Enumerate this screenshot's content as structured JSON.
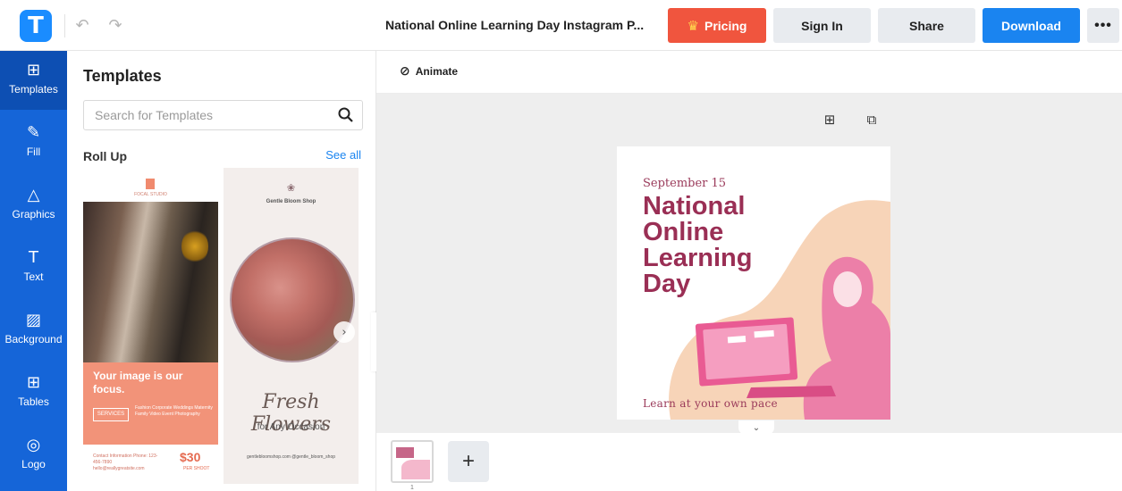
{
  "header": {
    "logo_letter": "T",
    "doc_title": "National Online Learning Day Instagram P...",
    "pricing_label": "Pricing",
    "signin_label": "Sign In",
    "share_label": "Share",
    "download_label": "Download",
    "more_label": "•••"
  },
  "rail": {
    "items": [
      {
        "label": "Templates",
        "icon": "templates-icon"
      },
      {
        "label": "Fill",
        "icon": "pencil-icon"
      },
      {
        "label": "Graphics",
        "icon": "graphics-icon"
      },
      {
        "label": "Text",
        "icon": "text-icon"
      },
      {
        "label": "Background",
        "icon": "background-icon"
      },
      {
        "label": "Tables",
        "icon": "table-icon"
      },
      {
        "label": "Logo",
        "icon": "logo-icon"
      }
    ],
    "active": "Templates"
  },
  "panel": {
    "title": "Templates",
    "search_placeholder": "Search for Templates",
    "section_title": "Roll Up",
    "see_all": "See all"
  },
  "cards": {
    "card1": {
      "brand": "FOCAL STUDIO",
      "headline": "Your image is our focus.",
      "services": "SERVICES",
      "services_list": "Fashion  Corporate Weddings  Maternity Family  Video Event  Photography",
      "footer": "Contact Information Phone: 123-456-7890 hello@reallygreatsite.com",
      "price": "$30",
      "price_sub": "PER SHOOT"
    },
    "card2": {
      "shop": "Gentle Bloom Shop",
      "script": "Fresh Flowers",
      "occasion": "for Any Occasion",
      "web": "gentlebloomshop.com @gentle_bloom_shop"
    }
  },
  "toolbar": {
    "animate_label": "Animate"
  },
  "design": {
    "date": "September 15",
    "headline": "National Online Learning Day",
    "tagline": "Learn at your own pace"
  },
  "pages": {
    "thumb_number": "1",
    "add_label": "+"
  },
  "colors": {
    "brand_blue": "#1a84f0",
    "pricing_red": "#f0553e",
    "rail_blue": "#1565d8",
    "design_maroon": "#9a2f55",
    "design_peach": "#f7d4b8",
    "design_pink": "#ec7fa8"
  }
}
